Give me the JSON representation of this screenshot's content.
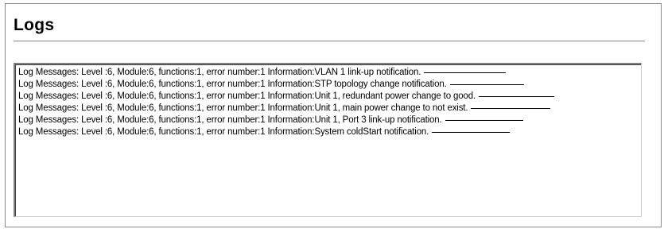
{
  "page": {
    "title": "Logs"
  },
  "logs": {
    "messages": [
      "Log Messages: Level :6, Module:6, functions:1, error number:1 Information:VLAN 1 link-up notification.",
      "Log Messages: Level :6, Module:6, functions:1, error number:1 Information:STP topology change notification.",
      "Log Messages: Level :6, Module:6, functions:1, error number:1 Information:Unit 1, redundant power change to good.",
      "Log Messages: Level :6, Module:6, functions:1, error number:1 Information:Unit 1, main power change to not exist.",
      "Log Messages: Level :6, Module:6, functions:1, error number:1 Information:Unit 1, Port 3 link-up notification.",
      "Log Messages: Level :6, Module:6, functions:1, error number:1 Information:System coldStart notification."
    ]
  }
}
